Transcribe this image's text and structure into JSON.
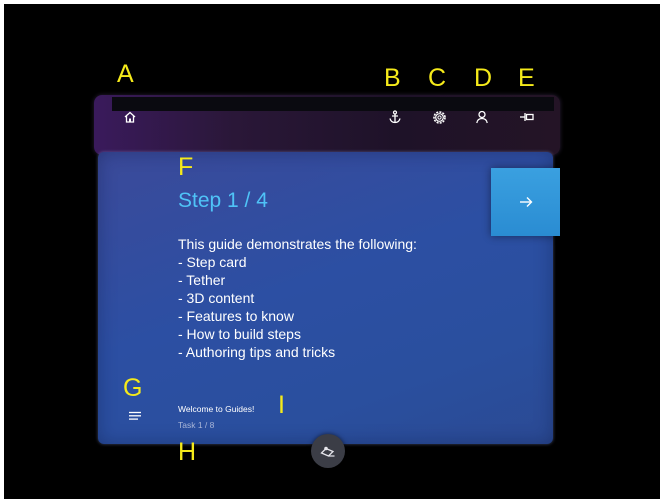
{
  "callouts": {
    "a": "A",
    "b": "B",
    "c": "C",
    "d": "D",
    "e": "E",
    "f": "F",
    "g": "G",
    "h": "H",
    "i": "I"
  },
  "app_bar": {
    "icons": [
      "home-icon",
      "anchor-icon",
      "settings-icon",
      "profile-icon",
      "pin-icon"
    ]
  },
  "step_card": {
    "title": "Step 1 / 4",
    "description": [
      "This guide demonstrates the following:",
      "- Step card",
      "- Tether",
      "- 3D content",
      "- Features to know",
      "- How to build steps",
      "- Authoring tips and tricks"
    ],
    "next_icon": "arrow-right-icon"
  },
  "footer": {
    "welcome": "Welcome to Guides!",
    "task": "Task 1 / 8",
    "menu_icon": "list-icon",
    "hologram_icon": "hologram-icon"
  },
  "colors": {
    "callout": "#f5ea1a",
    "step_title": "#4fc3f7",
    "card": "#2c4fa3",
    "next_button": "#2a8cd2"
  }
}
